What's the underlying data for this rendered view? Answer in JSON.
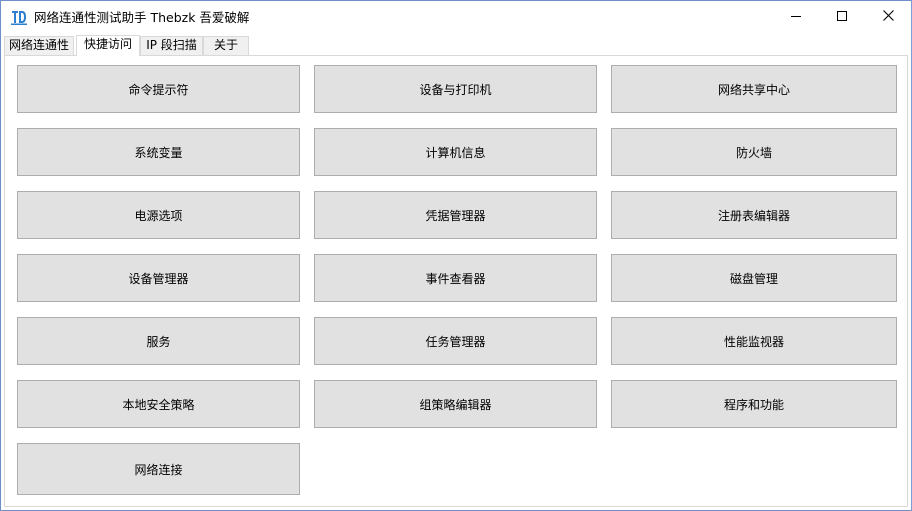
{
  "window": {
    "title": "网络连通性测试助手  Thebzk 吾爱破解"
  },
  "tabs": [
    {
      "label": "网络连通性"
    },
    {
      "label": "快捷访问"
    },
    {
      "label": "IP 段扫描"
    },
    {
      "label": "关于"
    }
  ],
  "quick_access": {
    "buttons": [
      {
        "label": "命令提示符"
      },
      {
        "label": "设备与打印机"
      },
      {
        "label": "网络共享中心"
      },
      {
        "label": "系统变量"
      },
      {
        "label": "计算机信息"
      },
      {
        "label": "防火墙"
      },
      {
        "label": "电源选项"
      },
      {
        "label": "凭据管理器"
      },
      {
        "label": "注册表编辑器"
      },
      {
        "label": "设备管理器"
      },
      {
        "label": "事件查看器"
      },
      {
        "label": "磁盘管理"
      },
      {
        "label": "服务"
      },
      {
        "label": "任务管理器"
      },
      {
        "label": "性能监视器"
      },
      {
        "label": "本地安全策略"
      },
      {
        "label": "组策略编辑器"
      },
      {
        "label": "程序和功能"
      },
      {
        "label": "网络连接"
      }
    ]
  },
  "icons": {
    "app": "app-logo-icon",
    "minimize": "minimize-icon",
    "maximize": "maximize-icon",
    "close": "close-icon"
  },
  "colors": {
    "accent": "#2e7fd0",
    "button_face": "#e1e1e1",
    "button_border": "#adadad"
  }
}
